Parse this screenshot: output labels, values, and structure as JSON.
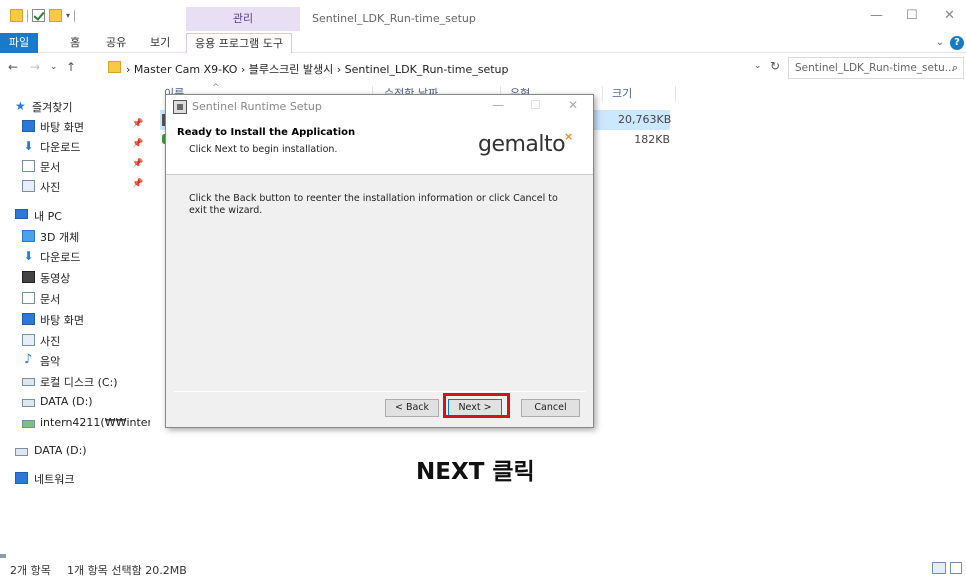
{
  "window": {
    "title": "Sentinel_LDK_Run-time_setup",
    "context_tab": "관리",
    "controls": {
      "minimize": "—",
      "maximize": "☐",
      "close": "✕"
    }
  },
  "ribbon": {
    "tabs": [
      "파일",
      "홈",
      "공유",
      "보기"
    ],
    "app_tools_tab": "응용 프로그램 도구",
    "help": "?"
  },
  "address": {
    "path": "›  Master Cam X9-KO  ›  블루스크린 발생시  ›  Sentinel_LDK_Run-time_setup",
    "search_placeholder": "Sentinel_LDK_Run-time_setu..."
  },
  "sidebar": {
    "quick_access": "즐겨찾기",
    "quick_items": [
      "바탕 화면",
      "다운로드",
      "문서",
      "사진"
    ],
    "this_pc": "내 PC",
    "pc_items": [
      "3D 개체",
      "다운로드",
      "동영상",
      "문서",
      "바탕 화면",
      "사진",
      "음악",
      "로컬 디스크 (C:)",
      "DATA (D:)",
      "intern4211(₩₩inter"
    ],
    "data_drive": "DATA (D:)",
    "network": "네트워크"
  },
  "file_list": {
    "columns": [
      "이름",
      "수정한 날짜",
      "유형",
      "크기"
    ],
    "sizes": [
      "20,763KB",
      "182KB"
    ]
  },
  "status": {
    "items": "2개 항목",
    "selected": "1개 항목 선택함 20.2MB"
  },
  "dialog": {
    "title": "Sentinel Runtime Setup",
    "heading": "Ready to Install the Application",
    "subheading": "Click Next to begin installation.",
    "logo": "gemalto",
    "body": "Click the Back button to reenter the installation information or click Cancel to exit the wizard.",
    "back_label": "< Back",
    "next_label": "Next >",
    "cancel_label": "Cancel"
  },
  "annotation": {
    "caption": "NEXT 클릭",
    "highlight_color": "#d3121e"
  },
  "colors": {
    "file_tab": "#1979ca",
    "selection": "#cce8ff",
    "manage_tab": "#e9dff5"
  }
}
